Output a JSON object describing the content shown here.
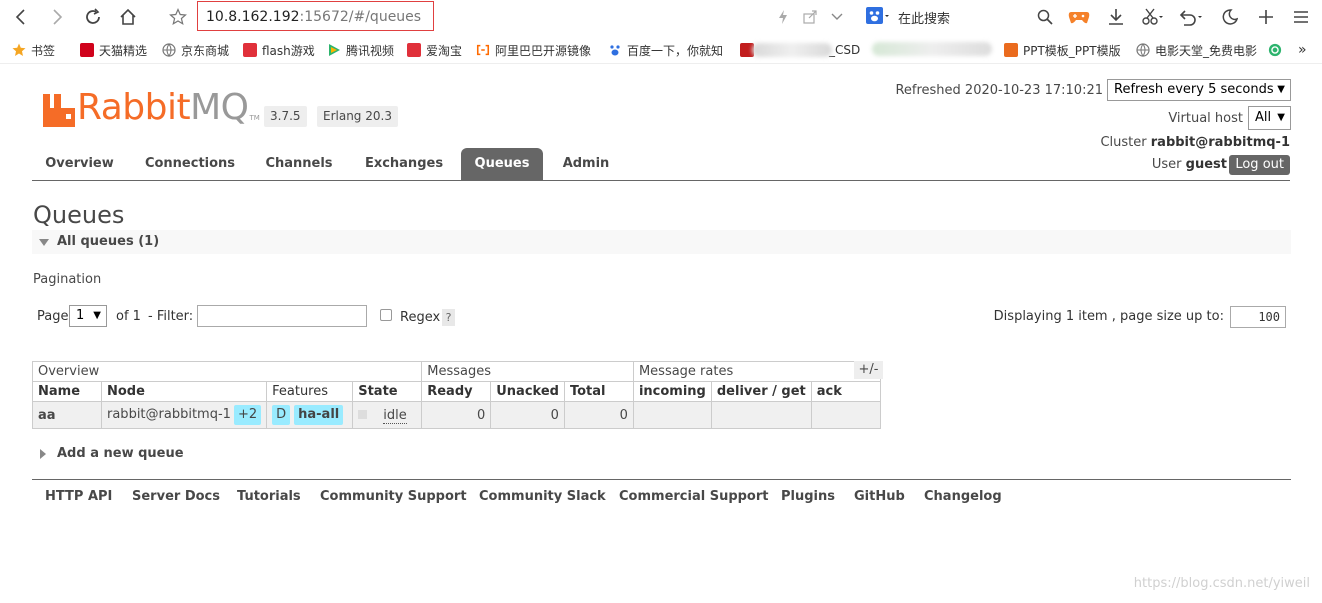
{
  "browser": {
    "url_host": "10.8.162.192",
    "url_rest": ":15672/#/queues",
    "search_label": "在此搜索",
    "bookmarks": [
      {
        "label": "书签",
        "color": "#f5a623"
      },
      {
        "label": "天猫精选",
        "color": "#d0021b"
      },
      {
        "label": "京东商城",
        "color": "#888888"
      },
      {
        "label": "flash游戏",
        "color": "#e0303a"
      },
      {
        "label": "腾讯视频",
        "color": "#2db46e"
      },
      {
        "label": "爱淘宝",
        "color": "#e0303a"
      },
      {
        "label": "阿里巴巴开源镜像",
        "color": "#ff6a00"
      },
      {
        "label": "百度一下，你就知",
        "color": "#2f6fe0"
      },
      {
        "label": "_CSD",
        "color": "#c21d1d"
      },
      {
        "label": "PPT模板_PPT模版",
        "color": "#ea6b1e"
      },
      {
        "label": "电影天堂_免费电影",
        "color": "#888888"
      }
    ]
  },
  "header": {
    "logo_rabbit": "Rabbit",
    "logo_mq": "MQ",
    "logo_tm": "TM",
    "version": "3.7.5",
    "erlang": "Erlang 20.3",
    "refreshed": "Refreshed 2020-10-23 17:10:21",
    "refresh_select": "Refresh every 5 seconds",
    "vhost_label": "Virtual host",
    "vhost_value": "All",
    "cluster_label": "Cluster",
    "cluster_value": "rabbit@rabbitmq-1",
    "user_label": "User",
    "user_value": "guest",
    "logout": "Log out"
  },
  "tabs": [
    "Overview",
    "Connections",
    "Channels",
    "Exchanges",
    "Queues",
    "Admin"
  ],
  "active_tab": "Queues",
  "page": {
    "title": "Queues",
    "section": "All queues (1)",
    "pagination_label": "Pagination",
    "page_label": "Page",
    "page_value": "1",
    "of_label": "of 1",
    "filter_label": "- Filter:",
    "regex_label": "Regex",
    "help": "?",
    "displaying": "Displaying 1 item , page size up to:",
    "page_size": "100"
  },
  "table": {
    "group_headers": [
      "Overview",
      "Messages",
      "Message rates"
    ],
    "columns": [
      "Name",
      "Node",
      "Features",
      "State",
      "Ready",
      "Unacked",
      "Total",
      "incoming",
      "deliver / get",
      "ack"
    ],
    "plusminus": "+/-",
    "rows": [
      {
        "name": "aa",
        "node": "rabbit@rabbitmq-1",
        "node_extra": "+2",
        "feature_d": "D",
        "feature_policy": "ha-all",
        "state": "idle",
        "ready": "0",
        "unacked": "0",
        "total": "0",
        "incoming": "",
        "deliver_get": "",
        "ack": ""
      }
    ]
  },
  "add_queue": "Add a new queue",
  "footer": [
    "HTTP API",
    "Server Docs",
    "Tutorials",
    "Community Support",
    "Community Slack",
    "Commercial Support",
    "Plugins",
    "GitHub",
    "Changelog"
  ],
  "watermark": "https://blog.csdn.net/yiweil",
  "colors": {
    "brand_orange": "#f56c27",
    "tab_active": "#666666",
    "feature_badge": "#99ebff",
    "address_border": "#e04040"
  }
}
